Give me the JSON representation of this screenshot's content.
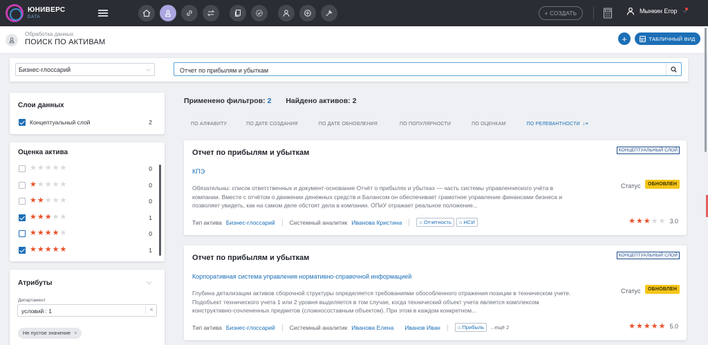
{
  "app": {
    "logo_title": "ЮНИВЕРС",
    "logo_sub": "DATA"
  },
  "topbar": {
    "create_label": "+ СОЗДАТЬ",
    "user_name": "Мынкин Егор",
    "nav_icons": [
      "home-icon",
      "assets-icon",
      "link-icon",
      "exchange-icon",
      "copy-icon",
      "settings-check-icon",
      "user-icon",
      "network-icon",
      "tools-icon"
    ]
  },
  "header": {
    "breadcrumb": "Обработка данных",
    "title": "ПОИСК ПО АКТИВАМ",
    "add_label": "+",
    "table_view_label": "ТАБЛИЧНЫЙ ВИД"
  },
  "search": {
    "scope_value": "Бизнес-глоссарий",
    "query": "Отчет по прибылям и убыткам"
  },
  "layers": {
    "title": "Слои данных",
    "items": [
      {
        "label": "Концептуальный слой",
        "count": "2",
        "checked": true
      }
    ]
  },
  "rating_filter": {
    "title": "Оценка актива",
    "rows": [
      {
        "stars": 0,
        "count": "0",
        "checked": false
      },
      {
        "stars": 1,
        "count": "0",
        "checked": false
      },
      {
        "stars": 2,
        "count": "0",
        "checked": false
      },
      {
        "stars": 3,
        "count": "1",
        "checked": true
      },
      {
        "stars": 4,
        "count": "0",
        "checked": false
      },
      {
        "stars": 5,
        "count": "1",
        "checked": true
      }
    ]
  },
  "attributes": {
    "title": "Атрибуты",
    "field_label": "Департамент",
    "field_value": "условий : 1",
    "chip": "Не пустое значение"
  },
  "results": {
    "applied_label": "Применено фильтров:",
    "applied_count": "2",
    "found_label": "Найдено активов: 2",
    "sort_options": [
      "ПО АЛФАВИТУ",
      "ПО ДАТЕ СОЗДАНИЯ",
      "ПО ДАТЕ ОБНОВЛЕНИЯ",
      "ПО ПОПУЛЯРНОСТИ",
      "ПО ОЦЕНКАМ",
      "ПО РЕЛЕВАНТНОСТИ"
    ],
    "sort_active": "ПО РЕЛЕВАНТНОСТИ",
    "cards": [
      {
        "title": "Отчет по прибылям и убыткам",
        "layer": "КОНЦЕПТУАЛЬНЫЙ СЛОЙ",
        "subtitle": "КПЭ",
        "description": "Обязательны: список ответственных и документ-основание Отчёт о прибылях и убытках — часть системы управленческого учёта в компании. Вместе с отчётом о движении денежных средств и Балансом он обеспечивает грамотное управление финансами бизнеса и позволяет увидеть, как на самом деле обстоят дела в компании. ОПиУ отражает реальное положение...",
        "status_label": "Статус",
        "status": "ОБНОВЛЕН",
        "type_label": "Тип актива",
        "type": "Бизнес-глоссарий",
        "analyst_label": "Системный аналитик",
        "analysts": [
          "Иванова Кристина"
        ],
        "tags": [
          "Отчетность",
          "НСИ"
        ],
        "more": "",
        "rating": 3,
        "rating_value": "3.0"
      },
      {
        "title": "Отчет по прибылям и убыткам",
        "layer": "КОНЦЕПТУАЛЬНЫЙ СЛОЙ",
        "subtitle": "Корпоративная система управления нормативно-справочной информацией",
        "description": "Глубина детализации активов сборочной структуры определяется требованиями обособленного отражения позиции в техническом учете. Подобъект технического учета 1 или 2 уровня выделяется в том случае, когда технический объект учета является комплексом конструктивно-сочлененных предметов (сложносоставным объектом). При этом в каждом конкретном...",
        "status_label": "Статус",
        "status": "ОБНОВЛЕН",
        "type_label": "Тип актива",
        "type": "Бизнес-глоссарий",
        "analyst_label": "Системный аналитик",
        "analysts": [
          "Иванова Елена",
          "Иванов Иван"
        ],
        "tags": [
          "Прибыль"
        ],
        "more": "...ещё 2",
        "rating": 5,
        "rating_value": "5.0"
      }
    ]
  },
  "colors": {
    "accent": "#1c6fb6",
    "topbar": "#2a2d33",
    "star": "#e8522a",
    "status": "#f5c518"
  }
}
